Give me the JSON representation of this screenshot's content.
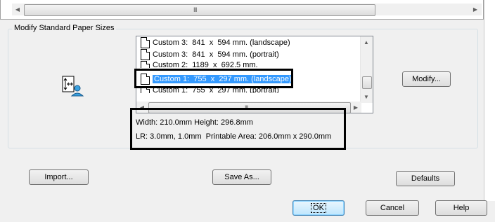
{
  "top_scrollbar": {
    "left_arrow": "◀",
    "right_arrow": "▶",
    "grip": "III"
  },
  "group": {
    "title": "Modify Standard Paper Sizes"
  },
  "paper_sizes": [
    {
      "label": "Custom 3:  841  x  594 mm. (landscape)",
      "selected": false
    },
    {
      "label": "Custom 3:  841  x  594 mm. (portrait)",
      "selected": false
    },
    {
      "label": "Custom 2:  1189  x  692.5 mm.",
      "selected": false
    },
    {
      "label": "Custom 1:  755  x  297 mm. (landscape)",
      "selected": true
    },
    {
      "label": "Custom 1:  755  x  297 mm. (portrait)",
      "selected": false
    }
  ],
  "list_scrollbar": {
    "up": "▲",
    "down": "▼",
    "left": "◀",
    "right": "▶",
    "grip": "III"
  },
  "info": {
    "dimensions": "Width: 210.0mm Height: 296.8mm",
    "margins": "LR: 3.0mm, 1.0mm  Printable Area: 206.0mm x 290.0mm"
  },
  "buttons": {
    "modify": "Modify...",
    "import": "Import...",
    "save_as": "Save As...",
    "defaults": "Defaults",
    "ok": "OK",
    "cancel": "Cancel",
    "help": "Help"
  },
  "icons": {
    "paper_size_icon": "page-user-icon"
  }
}
